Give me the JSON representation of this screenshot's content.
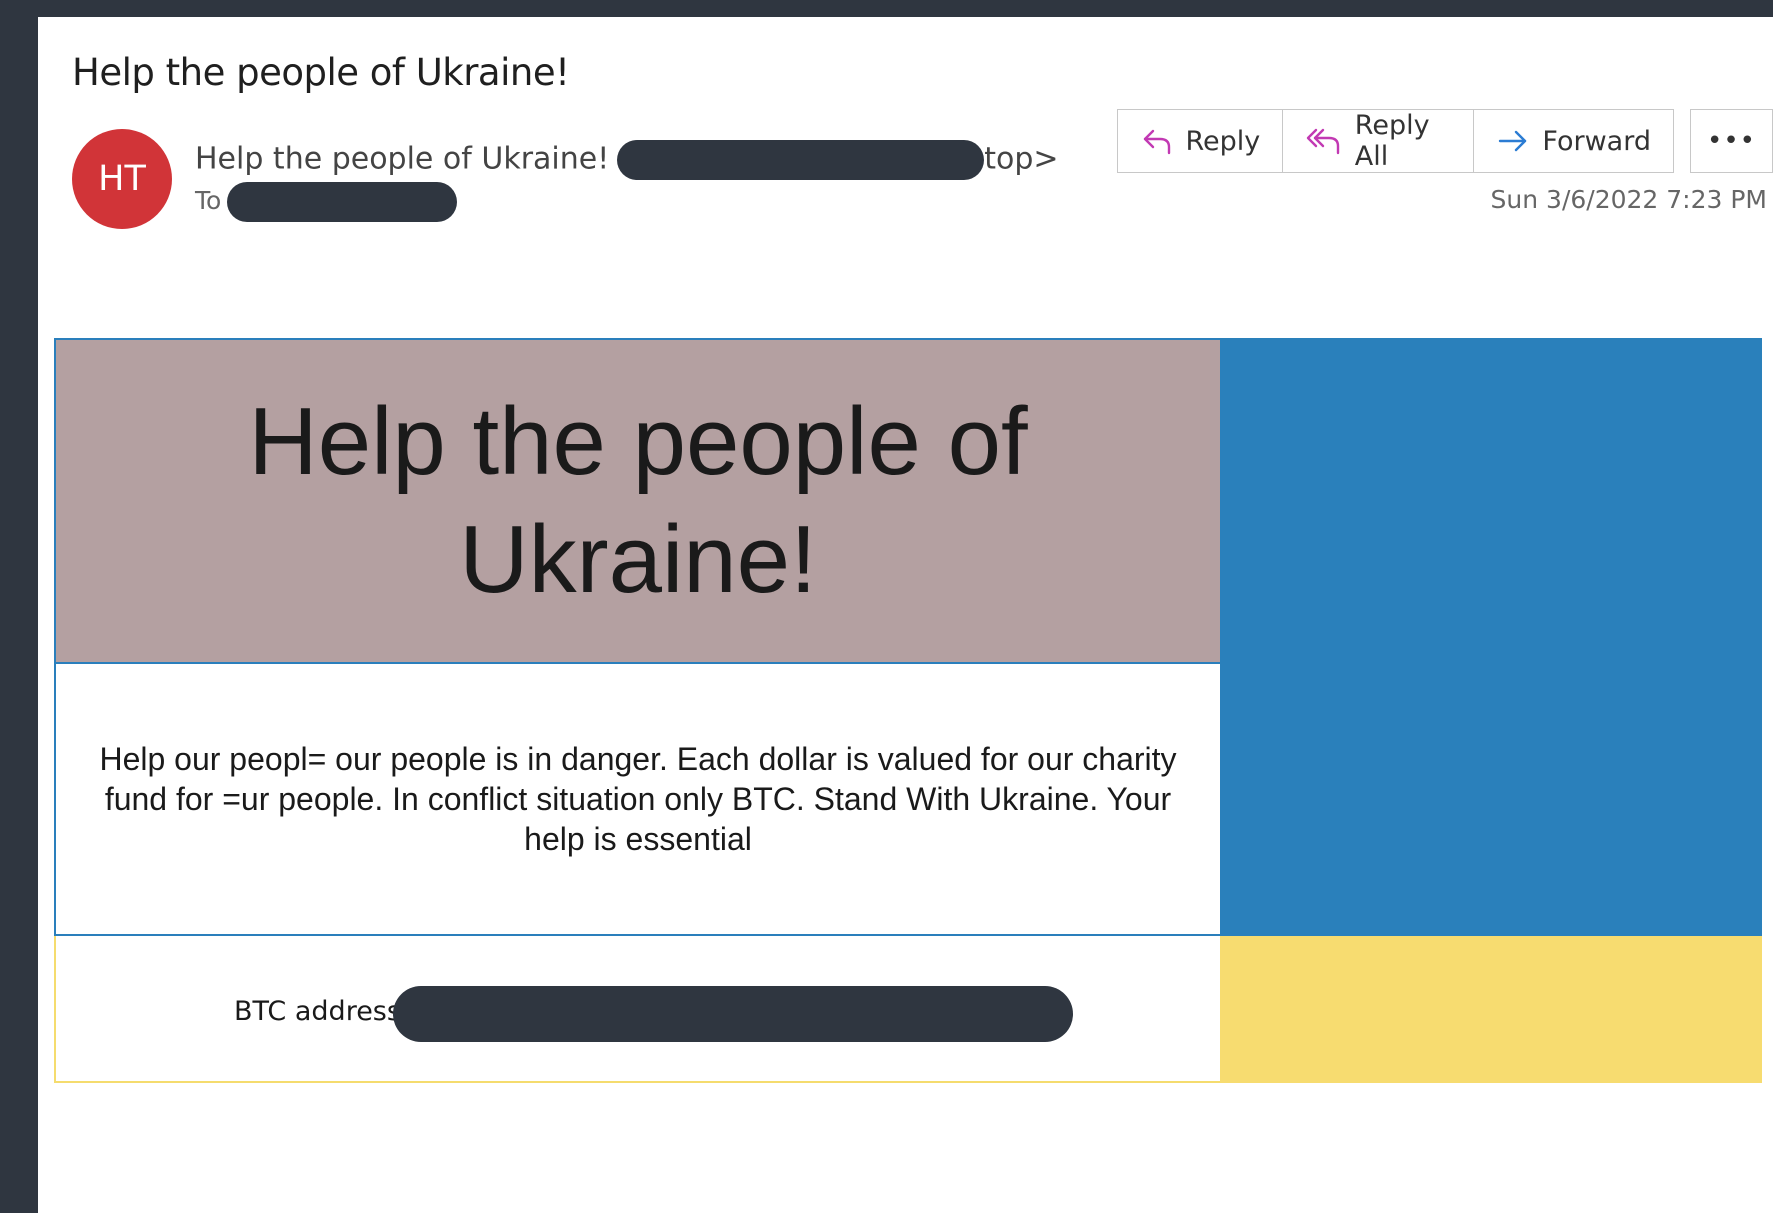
{
  "email": {
    "subject": "Help the people of Ukraine!",
    "avatar_initials": "HT",
    "sender_name": "Help the people of Ukraine!",
    "sender_suffix": "top>",
    "to_label": "To",
    "timestamp": "Sun 3/6/2022 7:23 PM"
  },
  "toolbar": {
    "reply_label": "Reply",
    "reply_all_label": "Reply All",
    "forward_label": "Forward",
    "more_label": "•••"
  },
  "body": {
    "hero_title": "Help the people of Ukraine!",
    "message": "Help our peopl= our people is in danger. Each dollar is valued for our charity fund for =ur people. In conflict situation only BTC. Stand With Ukraine. Your help is essential",
    "btc_label": "BTC address:"
  },
  "colors": {
    "avatar": "#d13438",
    "hero_bg": "#b4a0a1",
    "flag_blue": "#2a80bb",
    "flag_yellow": "#f7dc70",
    "redaction": "#2f3640",
    "reply_icon": "#c239b3",
    "forward_icon": "#2b7cd3"
  }
}
